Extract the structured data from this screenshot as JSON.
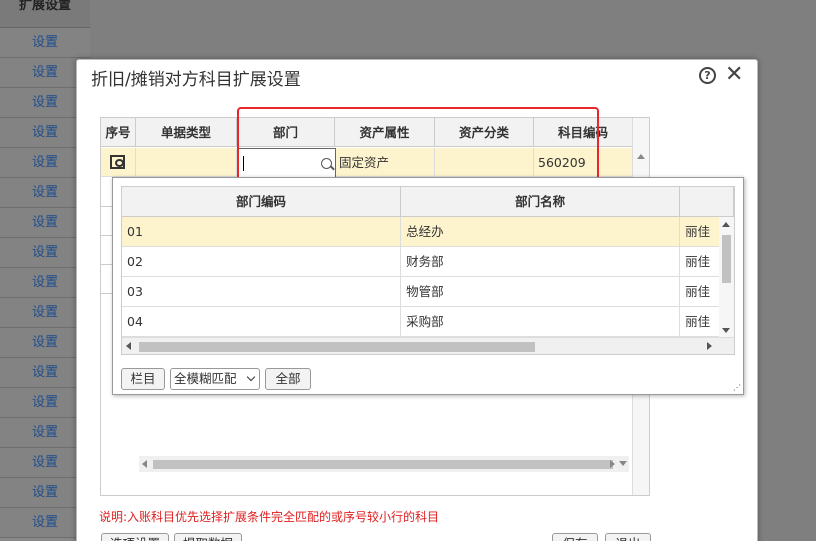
{
  "background": {
    "column_header": "扩展设置",
    "rows": [
      "设置",
      "设置",
      "设置",
      "设置",
      "设置",
      "设置",
      "设置",
      "设置",
      "设置",
      "设置",
      "设置",
      "设置",
      "设置",
      "设置",
      "设置",
      "设置",
      "设置"
    ]
  },
  "dialog": {
    "title": "折旧/摊销对方科目扩展设置",
    "help_label": "?",
    "close_label": "✕",
    "grid": {
      "columns": [
        "序号",
        "单据类型",
        "部门",
        "资产属性",
        "资产分类",
        "科目编码"
      ],
      "row": {
        "doc_type": "",
        "dept_value": "",
        "asset_attr": "固定资产",
        "asset_class": "",
        "account_code": "560209"
      }
    },
    "note": "说明:入账科目优先选择扩展条件完全匹配的或序号较小行的科目",
    "buttons": {
      "options": "选项设置",
      "fetch": "提取数据",
      "save": "保存",
      "exit": "退出"
    }
  },
  "popup": {
    "columns": [
      "部门编码",
      "部门名称",
      ""
    ],
    "rows": [
      {
        "code": "01",
        "name": "总经办",
        "extra": "丽佳"
      },
      {
        "code": "02",
        "name": "财务部",
        "extra": "丽佳"
      },
      {
        "code": "03",
        "name": "物管部",
        "extra": "丽佳"
      },
      {
        "code": "04",
        "name": "采购部",
        "extra": "丽佳"
      }
    ],
    "column_button": "栏目",
    "match_mode": "全模糊匹配",
    "all_button": "全部"
  },
  "colors": {
    "highlight": "#e8262b",
    "selected_row": "#fdf4cd",
    "note_text": "#e02020"
  }
}
